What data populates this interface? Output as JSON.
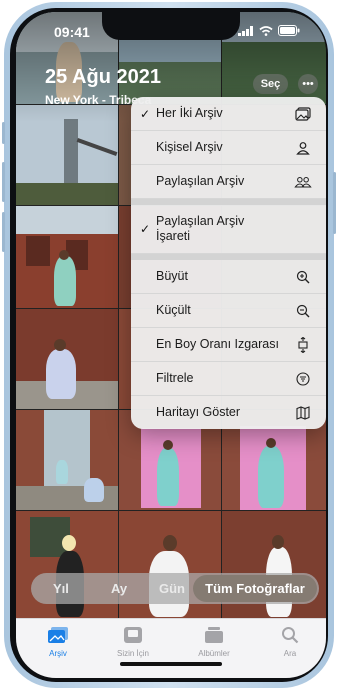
{
  "status": {
    "time": "09:41"
  },
  "header": {
    "date": "25 Ağu 2021",
    "location": "New York - Tribeca",
    "select_label": "Seç",
    "more_label": "•••"
  },
  "menu": {
    "items": [
      {
        "label": "Her İki Arşiv",
        "checked": true,
        "icon": "photo-library-icon"
      },
      {
        "label": "Kişisel Arşiv",
        "checked": false,
        "icon": "person-icon"
      },
      {
        "label": "Paylaşılan Arşiv",
        "checked": false,
        "icon": "people-icon"
      },
      {
        "label": "Paylaşılan Arşiv İşareti",
        "checked": true,
        "icon": ""
      },
      {
        "label": "Büyüt",
        "checked": false,
        "icon": "zoom-in-icon"
      },
      {
        "label": "Küçült",
        "checked": false,
        "icon": "zoom-out-icon"
      },
      {
        "label": "En Boy Oranı Izgarası",
        "checked": false,
        "icon": "aspect-ratio-icon"
      },
      {
        "label": "Filtrele",
        "checked": false,
        "icon": "filter-icon"
      },
      {
        "label": "Haritayı Göster",
        "checked": false,
        "icon": "map-icon"
      }
    ],
    "check_mark": "✓"
  },
  "segments": {
    "year": "Yıl",
    "month": "Ay",
    "day": "Gün",
    "all": "Tüm Fotoğraflar",
    "selected": "Tüm Fotoğraflar"
  },
  "tabs": {
    "library": "Arşiv",
    "for_you": "Sizin İçin",
    "albums": "Albümler",
    "search": "Ara",
    "active": "Arşiv"
  },
  "colors": {
    "accent": "#1a7fe6",
    "device_frame": "#b7cfe4"
  }
}
